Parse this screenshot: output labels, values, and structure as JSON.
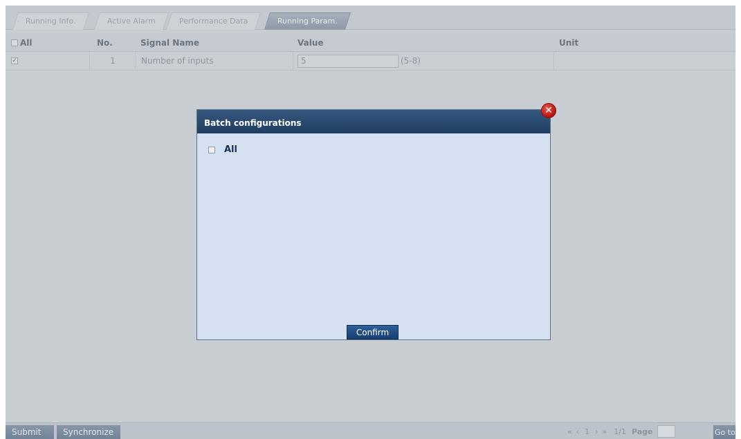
{
  "tabs": [
    {
      "label": "Running Info."
    },
    {
      "label": "Active Alarm"
    },
    {
      "label": "Performance Data"
    },
    {
      "label": "Running Param."
    }
  ],
  "active_tab": "Running Param.",
  "table": {
    "headers": {
      "all": "All",
      "no": "No.",
      "signal_name": "Signal Name",
      "value": "Value",
      "unit": "Unit"
    },
    "rows": [
      {
        "checked": true,
        "no": "1",
        "signal_name": "Number of inputs",
        "value": "5",
        "range": "(5-8)",
        "unit": ""
      }
    ]
  },
  "modal": {
    "title": "Batch configurations",
    "all_label": "All",
    "confirm_label": "Confirm"
  },
  "bottom": {
    "submit_label": "Submit",
    "synchronize_label": "Synchronize",
    "page_num": "1",
    "page_info": "1/1",
    "page_label": "Page",
    "goto_label": "Go to"
  },
  "colors": {
    "modal_header": "#203e63",
    "modal_body": "#d5e1f1",
    "close_button": "#c8211b",
    "overlay": "#c8cdd2"
  }
}
